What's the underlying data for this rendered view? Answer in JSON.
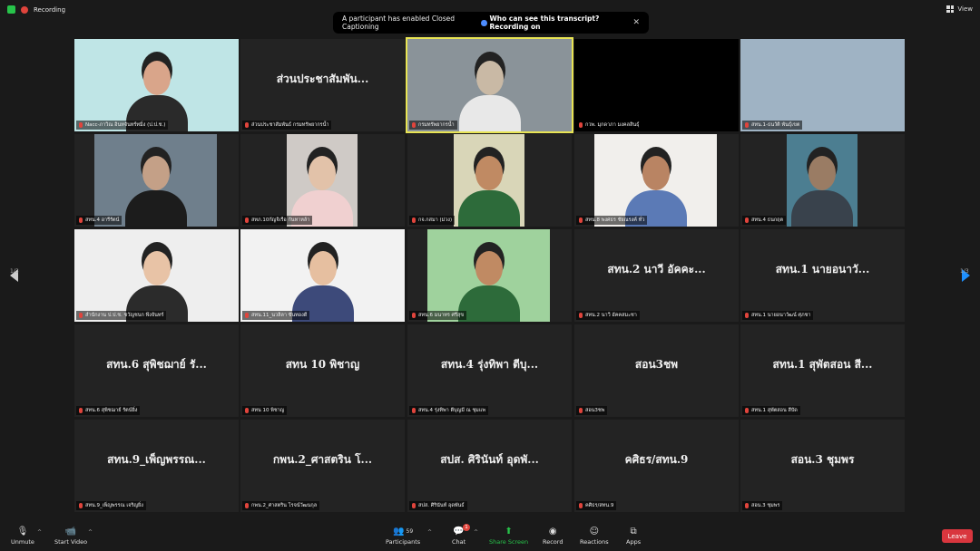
{
  "topbar": {
    "recording_label": "Recording",
    "view_label": "View"
  },
  "banner": {
    "message": "A participant has enabled Closed Captioning",
    "question": "Who can see this transcript? Recording on"
  },
  "pager": {
    "left": "1/3",
    "right": "1/3"
  },
  "tiles": [
    {
      "name": "",
      "label": "Nacc-ภาวิณ อินทจันทร์ทมิ่ง (ป.ป.ช.)",
      "video": true
    },
    {
      "name": "ส่วนประชาสัมพัน...",
      "label": "ส่วนประชาสัมพันธ์ กรมทรัพยากรน้ำ",
      "video": false
    },
    {
      "name": "",
      "label": "กรมทรัพยากรน้ำ",
      "video": true
    },
    {
      "name": "",
      "label": "กวพ. มุกดาภา มงคลสินธุ์",
      "video": true
    },
    {
      "name": "",
      "label": "สทน.1-ธนวัติ พันธุ์เขต",
      "video": true
    },
    {
      "name": "",
      "label": "สทน.4 อารีรัตน์",
      "video": true
    },
    {
      "name": "",
      "label": "สทภ.10กัญจิเรือ กันทาหล้า",
      "video": true
    },
    {
      "name": "",
      "label": "กจ.กสมา (ม่วง)",
      "video": true
    },
    {
      "name": "",
      "label": "สทน.8 พงศธร ชัยณรงค์ ทั่ว",
      "video": true
    },
    {
      "name": "",
      "label": "สทน.4 ธนกฤต",
      "video": true
    },
    {
      "name": "",
      "label": "สำนักงาน ป.ป.ช. ชวัญชนก พึงจันทร์",
      "video": true
    },
    {
      "name": "",
      "label": "สทน.11_นวลิลา ขันทองดี",
      "video": true
    },
    {
      "name": "",
      "label": "สทน.6 มนาทร ศรีสุข",
      "video": true
    },
    {
      "name": "สทน.2 นาวี อัคคะ...",
      "label": "สทน.2 นาวี อัคคสมะชา",
      "video": false
    },
    {
      "name": "สทน.1 นายอนาวั...",
      "label": "สทน.1 นายอนาวัฒน์ ศุภชา",
      "video": false
    },
    {
      "name": "สทน.6 สุพิชฌาย์ รั...",
      "label": "สทน.6 สุพิชฌาย์ รัตน์ยิ่ง",
      "video": false
    },
    {
      "name": "สทน 10 พิชาญ",
      "label": "สทน 10 พิชาญ",
      "video": false
    },
    {
      "name": "สทน.4 รุ่งทิพา ตีบุ...",
      "label": "สทน.4 รุ่งทิพา ตีบุญมี ณ ชุมแพ",
      "video": false
    },
    {
      "name": "สอน3ชพ",
      "label": "สอน3ชพ",
      "video": false
    },
    {
      "name": "สทน.1 สุพัตสอน สี...",
      "label": "สทน.1 สุพัตสอน สีบัด",
      "video": false
    },
    {
      "name": "สทน.9_เพ็ญพรรณ...",
      "label": "สทน.9_เพ็ญพรรณ เจริญยิ่ง",
      "video": false
    },
    {
      "name": "กพน.2_ศาสตริน โ...",
      "label": "กพน.2_ศาสตริน โรจน์วัฒนกุล",
      "video": false
    },
    {
      "name": "สปส. ศิรินันท์ อุดพั...",
      "label": "สปส. ศิรินันท์ อุดพันธ์",
      "video": false
    },
    {
      "name": "คศิธร/สทน.9",
      "label": "คศิธร/สทน.9",
      "video": false
    },
    {
      "name": "สอน.3 ชุมพร",
      "label": "สอน.3 ชุมพร",
      "video": false
    }
  ],
  "toolbar": {
    "unmute": "Unmute",
    "start_video": "Start Video",
    "participants": "Participants",
    "participants_count": "59",
    "chat": "Chat",
    "chat_badge": "1",
    "share_screen": "Share Screen",
    "record": "Record",
    "reactions": "Reactions",
    "apps": "Apps",
    "leave": "Leave"
  }
}
